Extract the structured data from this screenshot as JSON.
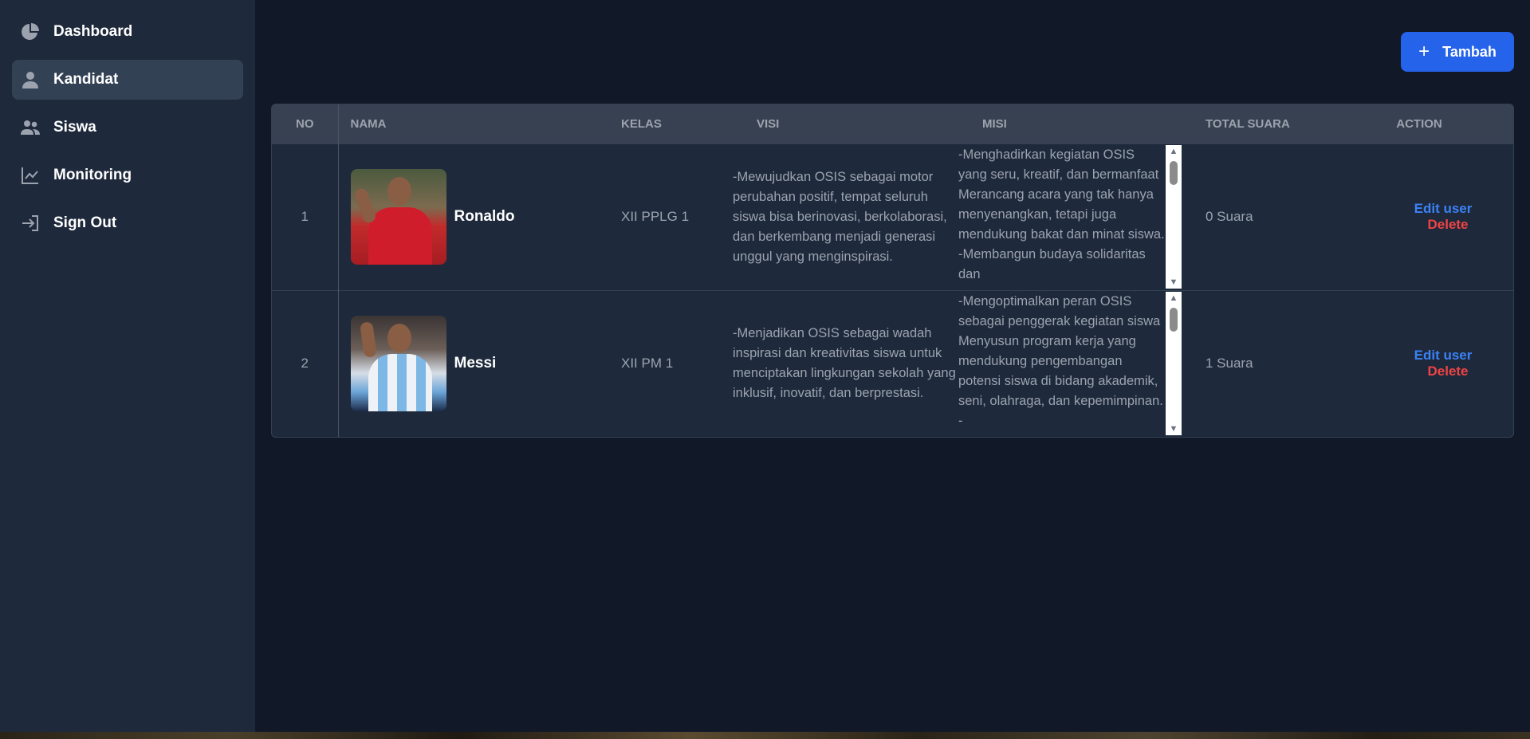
{
  "sidebar": {
    "items": [
      {
        "label": "Dashboard",
        "icon": "pie-chart-icon",
        "active": false
      },
      {
        "label": "Kandidat",
        "icon": "user-icon",
        "active": true
      },
      {
        "label": "Siswa",
        "icon": "users-icon",
        "active": false
      },
      {
        "label": "Monitoring",
        "icon": "line-chart-icon",
        "active": false
      },
      {
        "label": "Sign Out",
        "icon": "sign-out-icon",
        "active": false
      }
    ]
  },
  "toolbar": {
    "add_label": "Tambah",
    "add_icon": "plus-icon"
  },
  "table": {
    "headers": {
      "no": "NO",
      "nama": "NAMA",
      "kelas": "KELAS",
      "visi": "VISI",
      "misi": "MISI",
      "total": "TOTAL SUARA",
      "action": "ACTION"
    },
    "rows": [
      {
        "no": "1",
        "nama": "Ronaldo",
        "kelas": "XII PPLG 1",
        "visi": "-Mewujudkan OSIS sebagai motor perubahan positif, tempat seluruh siswa bisa berinovasi, berkolaborasi, dan berkembang menjadi generasi unggul yang menginspirasi.",
        "misi": "-Menghadirkan kegiatan OSIS yang seru, kreatif, dan bermanfaat Merancang acara yang tak hanya menyenangkan, tetapi juga mendukung bakat dan minat siswa. -Membangun budaya solidaritas dan",
        "total": "0 Suara",
        "edit_label": "Edit user",
        "delete_label": "Delete"
      },
      {
        "no": "2",
        "nama": "Messi",
        "kelas": "XII PM 1",
        "visi": "-Menjadikan OSIS sebagai wadah inspirasi dan kreativitas siswa untuk menciptakan lingkungan sekolah yang inklusif, inovatif, dan berprestasi.",
        "misi": "-Mengoptimalkan peran OSIS sebagai penggerak kegiatan siswa Menyusun program kerja yang mendukung pengembangan potensi siswa di bidang akademik, seni, olahraga, dan kepemimpinan. -",
        "total": "1 Suara",
        "edit_label": "Edit user",
        "delete_label": "Delete"
      }
    ]
  },
  "colors": {
    "sidebar_bg": "#1e293b",
    "main_bg": "#111827",
    "accent": "#2563eb",
    "edit": "#3b82f6",
    "delete": "#ef4444"
  }
}
